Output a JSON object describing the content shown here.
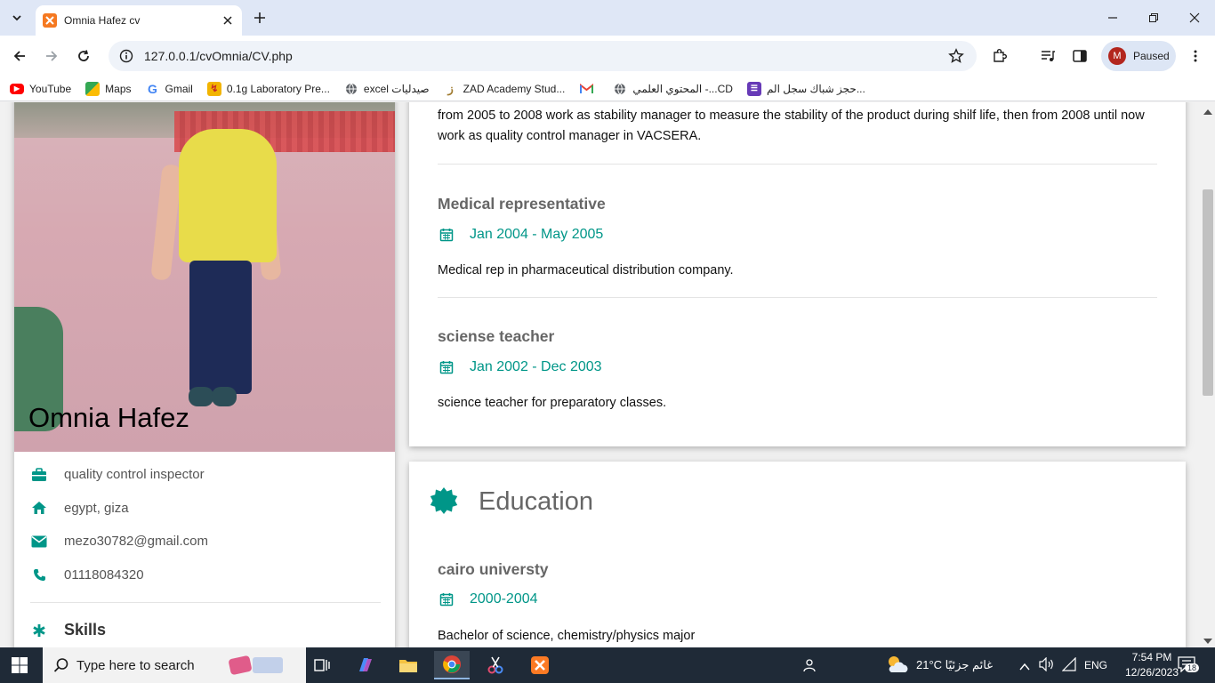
{
  "browser": {
    "tab_title": "Omnia Hafez cv",
    "url": "127.0.0.1/cvOmnia/CV.php",
    "profile_initial": "M",
    "profile_status": "Paused",
    "bookmarks": [
      {
        "label": "YouTube",
        "icon": "youtube-icon",
        "color": "#ff0000"
      },
      {
        "label": "Maps",
        "icon": "maps-icon",
        "color": "#34a853"
      },
      {
        "label": "Gmail",
        "icon": "google-icon",
        "color": "#4285f4"
      },
      {
        "label": "0.1g Laboratory Pre...",
        "icon": "lab-icon",
        "color": "#f2b400"
      },
      {
        "label": "excel صيدليات",
        "icon": "globe-icon",
        "color": "#5f6368"
      },
      {
        "label": "ZAD Academy Stud...",
        "icon": "zad-icon",
        "color": "#a07b2f"
      },
      {
        "label": "",
        "icon": "gmail-icon",
        "color": "#ea4335"
      },
      {
        "label": "المحتوي العلمي -...CD",
        "icon": "globe-icon",
        "color": "#5f6368"
      },
      {
        "label": "حجز شباك سجل الم...",
        "icon": "forms-icon",
        "color": "#673ab7"
      }
    ]
  },
  "profile": {
    "name": "Omnia Hafez",
    "job": "quality control inspector",
    "location": "egypt, giza",
    "email": "mezo30782@gmail.com",
    "phone": "01118084320",
    "skills_label": "Skills"
  },
  "experience": {
    "current_desc": "from 2005 to 2008 work as stability manager to measure the stability of the product during shilf life, then from 2008 until now work as quality control manager in VACSERA.",
    "entries": [
      {
        "title": "Medical representative",
        "date": "Jan 2004 - May 2005",
        "desc": "Medical rep in pharmaceutical distribution company."
      },
      {
        "title": "sciense teacher",
        "date": "Jan 2002 - Dec 2003",
        "desc": "science teacher for preparatory classes."
      }
    ]
  },
  "education": {
    "heading": "Education",
    "entries": [
      {
        "title": "cairo universty",
        "date": "2000-2004",
        "desc": "Bachelor of science, chemistry/physics major"
      }
    ]
  },
  "taskbar": {
    "search_placeholder": "Type here to search",
    "weather": "21°C  غائم جزئيًا",
    "lang": "ENG",
    "time": "7:54 PM",
    "date": "12/26/2023",
    "notifications": "18"
  },
  "colors": {
    "accent": "#009688",
    "text_muted": "#666666"
  }
}
